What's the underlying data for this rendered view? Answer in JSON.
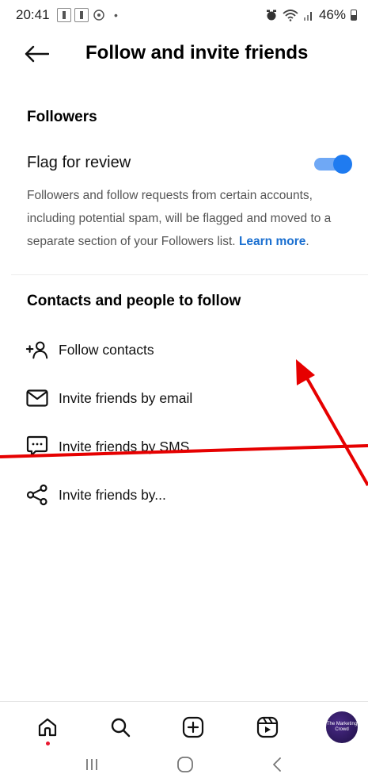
{
  "status_bar": {
    "time": "20:41",
    "battery": "46%"
  },
  "header": {
    "title": "Follow and invite friends"
  },
  "followers_section": {
    "title": "Followers",
    "flag_label": "Flag for review",
    "flag_enabled": true,
    "description": "Followers and follow requests from certain accounts, including potential spam, will be flagged and moved to a separate section of your Followers list.",
    "learn_more": "Learn more",
    "period": "."
  },
  "contacts_section": {
    "title": "Contacts and people to follow",
    "items": [
      {
        "label": "Follow contacts",
        "icon": "add-person-icon"
      },
      {
        "label": "Invite friends by email",
        "icon": "envelope-icon"
      },
      {
        "label": "Invite friends by SMS",
        "icon": "sms-bubble-icon"
      },
      {
        "label": "Invite friends by...",
        "icon": "share-icon"
      }
    ]
  },
  "bottom_nav": {
    "items": [
      "home-icon",
      "search-icon",
      "create-icon",
      "reels-icon",
      "profile-avatar"
    ],
    "avatar_text": "The Marketing Crowd"
  },
  "colors": {
    "toggle_on": "#1f7bf0",
    "link": "#1a6fd0",
    "annotation": "#e60000"
  }
}
